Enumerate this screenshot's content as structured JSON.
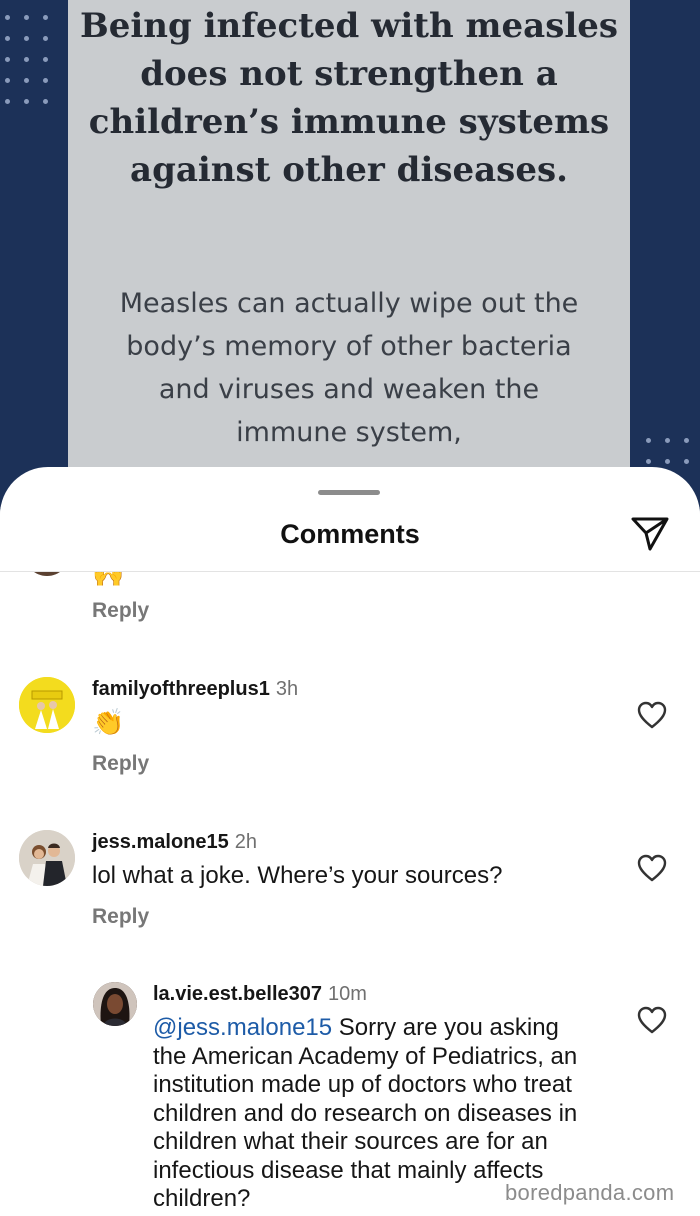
{
  "post": {
    "title": "Being infected with measles does not strengthen a children’s immune systems against other diseases.",
    "body": "Measles can actually wipe out the body’s memory of other bacteria and viruses and weaken the immune system,",
    "colors": {
      "background": "#1c3158",
      "card": "#c9cccf"
    }
  },
  "sheet": {
    "title": "Comments",
    "send_icon": "send-icon"
  },
  "comments": [
    {
      "emoji": "🙌",
      "reply_label": "Reply"
    },
    {
      "username": "familyofthreeplus1",
      "time": "3h",
      "emoji": "👏",
      "reply_label": "Reply",
      "like_icon": "heart-icon"
    },
    {
      "username": "jess.malone15",
      "time": "2h",
      "text": "lol what a joke. Where’s your sources?",
      "reply_label": "Reply",
      "like_icon": "heart-icon"
    },
    {
      "username": "la.vie.est.belle307",
      "time": "10m",
      "mention": "@jess.malone15",
      "text": " Sorry are you asking the American Academy of Pediatrics, an institution made up of doctors who treat children and do research on diseases in children what their sources are for an infectious disease that mainly affects children?",
      "like_icon": "heart-icon"
    }
  ],
  "watermark": "boredpanda.com"
}
